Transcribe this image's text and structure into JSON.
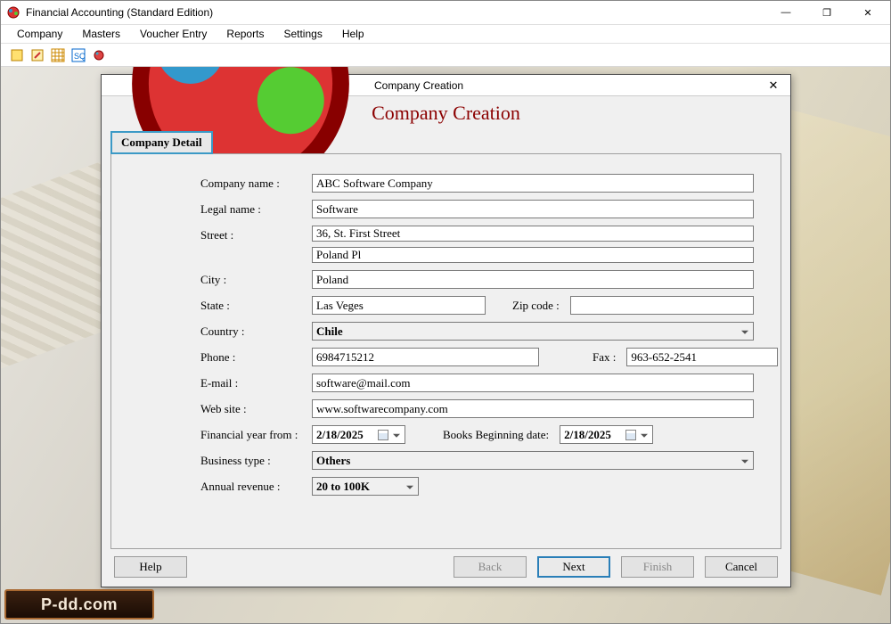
{
  "app": {
    "title": "Financial Accounting (Standard Edition)"
  },
  "menubar": {
    "items": [
      "Company",
      "Masters",
      "Voucher Entry",
      "Reports",
      "Settings",
      "Help"
    ]
  },
  "dialog": {
    "title": "Company Creation",
    "heading": "Company Creation",
    "tab": "Company Detail",
    "labels": {
      "company_name": "Company name :",
      "legal_name": "Legal name :",
      "street": "Street :",
      "city": "City :",
      "state": "State :",
      "zip": "Zip code :",
      "country": "Country :",
      "phone": "Phone :",
      "fax": "Fax :",
      "email": "E-mail :",
      "website": "Web site :",
      "fy_from": "Financial year from :",
      "books_begin": "Books Beginning date:",
      "business_type": "Business type :",
      "annual_revenue": "Annual revenue :"
    },
    "values": {
      "company_name": "ABC Software Company",
      "legal_name": "Software",
      "street1": "36, St. First Street",
      "street2": "Poland Pl",
      "city": "Poland",
      "state": "Las Veges",
      "zip": "",
      "country": "Chile",
      "phone": "6984715212",
      "fax": "963-652-2541",
      "email": "software@mail.com",
      "website": "www.softwarecompany.com",
      "fy_from": "2/18/2025",
      "books_begin": "2/18/2025",
      "business_type": "Others",
      "annual_revenue": "20 to 100K"
    },
    "buttons": {
      "help": "Help",
      "back": "Back",
      "next": "Next",
      "finish": "Finish",
      "cancel": "Cancel"
    }
  },
  "watermark": "P-dd.com"
}
